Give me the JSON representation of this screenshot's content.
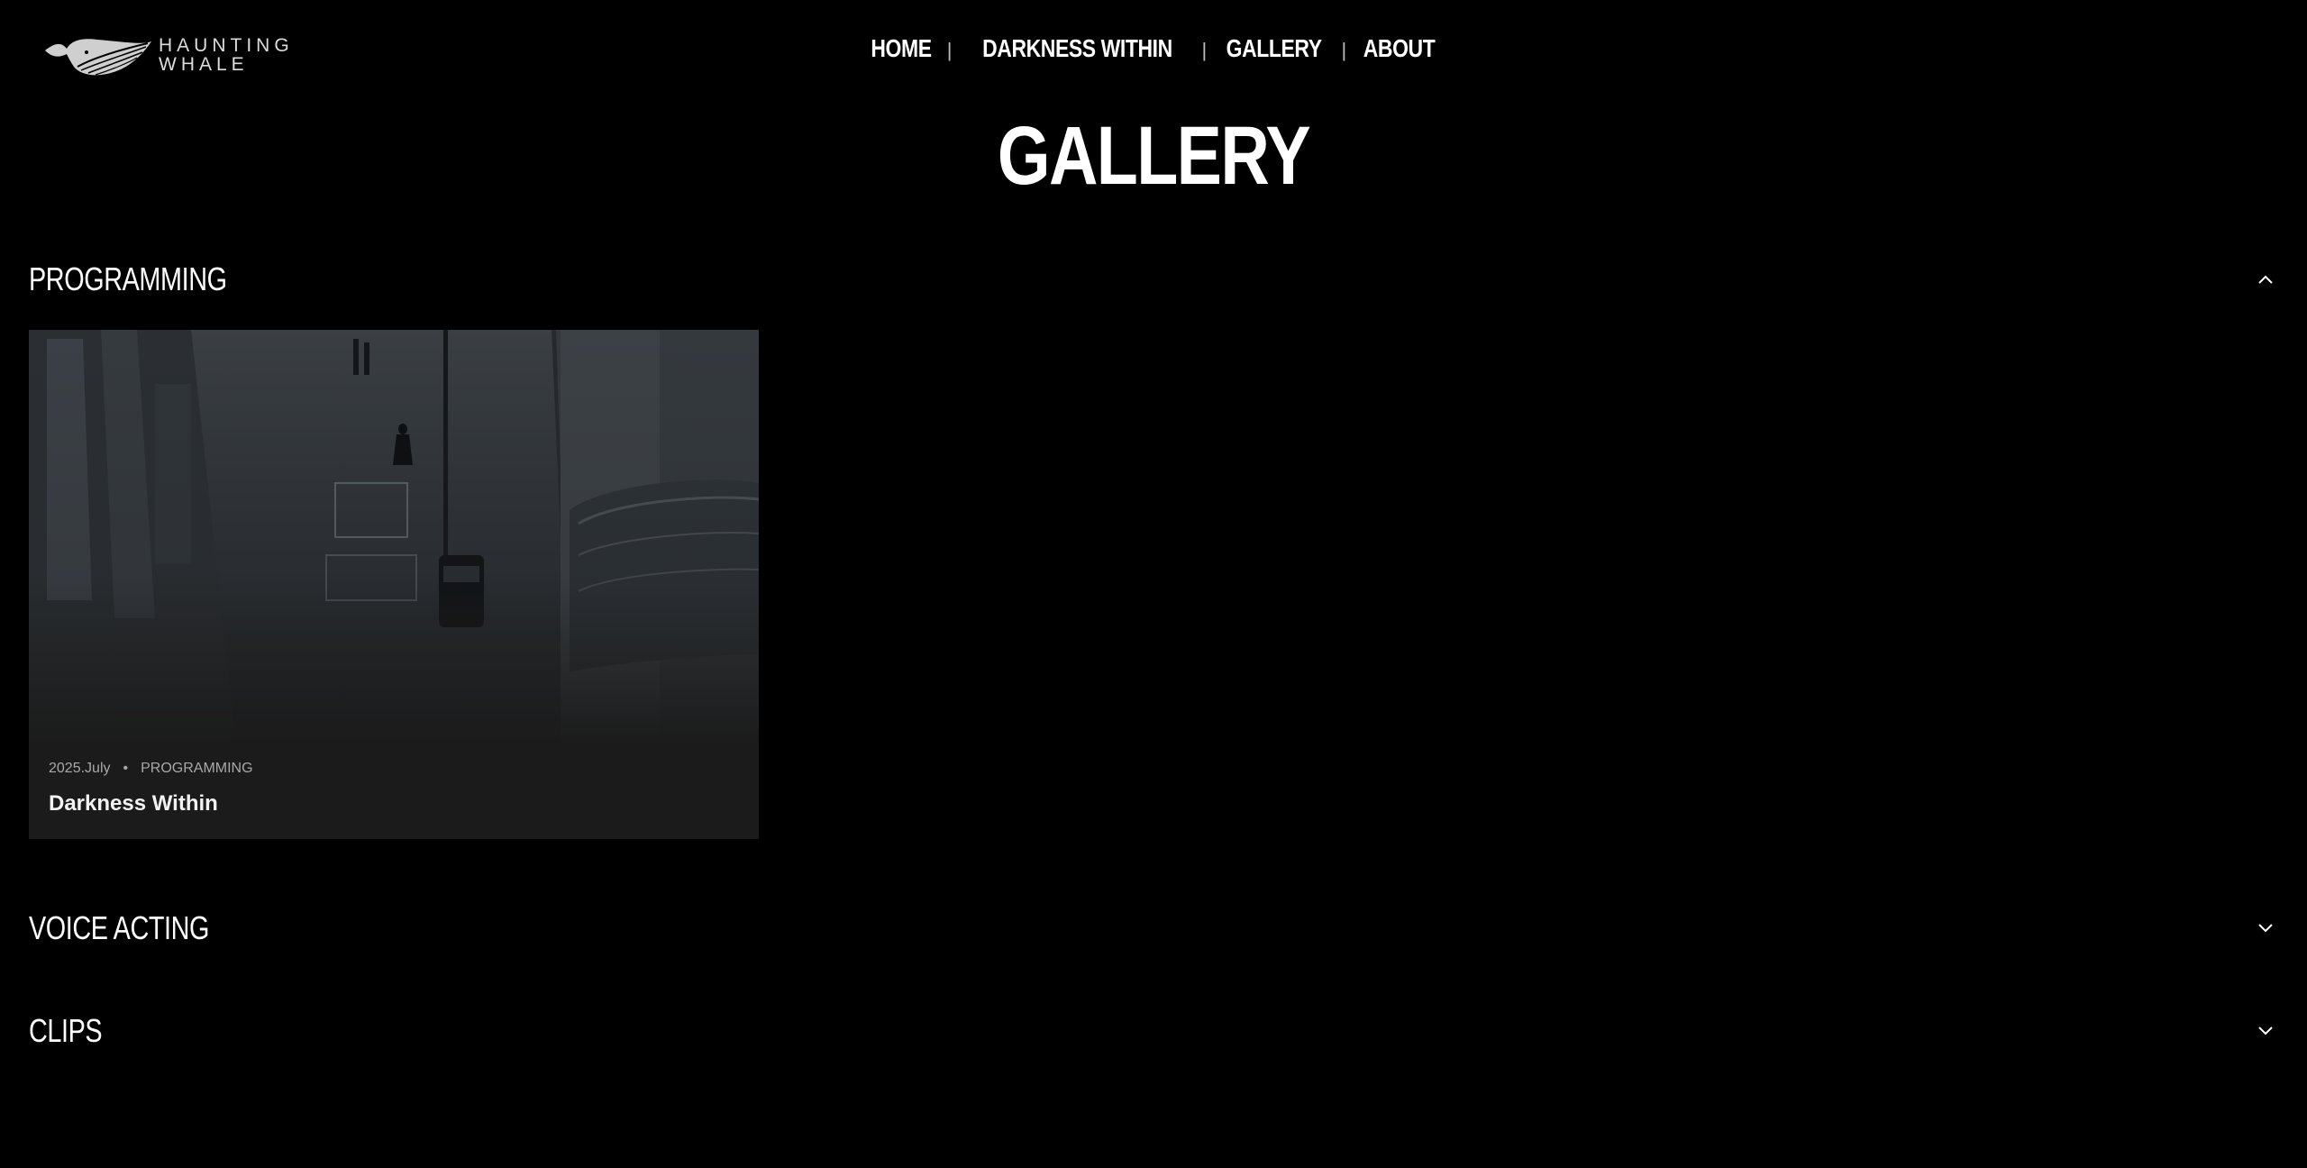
{
  "brand": {
    "line1": "HAUNTING",
    "line2": "WHALE",
    "logo_icon": "whale-logo-icon"
  },
  "nav": {
    "items": [
      {
        "label": "HOME"
      },
      {
        "label": "DARKNESS WITHIN"
      },
      {
        "label": "GALLERY"
      },
      {
        "label": "ABOUT"
      }
    ],
    "separator": "|"
  },
  "page": {
    "title": "GALLERY"
  },
  "sections": [
    {
      "title": "PROGRAMMING",
      "expanded": true,
      "icon": "chevron-up-icon",
      "cards": [
        {
          "date": "2025.July",
          "bullet": "•",
          "category": "PROGRAMMING",
          "title": "Darkness Within"
        }
      ]
    },
    {
      "title": "VOICE ACTING",
      "expanded": false,
      "icon": "chevron-down-icon"
    },
    {
      "title": "CLIPS",
      "expanded": false,
      "icon": "chevron-down-icon"
    }
  ],
  "colors": {
    "background": "#000000",
    "text": "#ffffff",
    "card_background": "#1b1b1b",
    "meta_text": "#a8a8a8"
  }
}
